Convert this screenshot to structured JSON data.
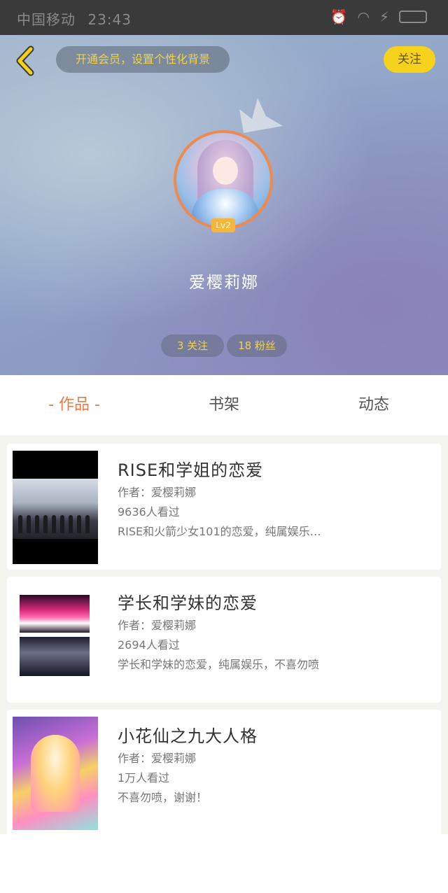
{
  "status_bar": {
    "carrier": "中国移动",
    "time": "23:43",
    "icons": [
      "alarm-icon",
      "wifi-icon",
      "charging-icon",
      "battery-icon"
    ]
  },
  "header": {
    "back_icon": "chevron-left-icon",
    "vip_promo": "开通会员，设置个性化背景",
    "follow_label": "关注"
  },
  "profile": {
    "level": "Lv2",
    "username": "爱樱莉娜",
    "following": "3 关注",
    "fans": "18 粉丝"
  },
  "tabs": [
    {
      "label": "- 作品 -",
      "active": true
    },
    {
      "label": "书架",
      "active": false
    },
    {
      "label": "动态",
      "active": false
    }
  ],
  "works": [
    {
      "title": "RISE和学姐的恋爱",
      "author": "作者：爱樱莉娜",
      "views": "9636人看过",
      "desc": "RISE和火箭少女101的恋爱，纯属娱乐…"
    },
    {
      "title": "学长和学妹的恋爱",
      "author": "作者：爱樱莉娜",
      "views": "2694人看过",
      "desc": "学长和学妹的恋爱，纯属娱乐，不喜勿喷"
    },
    {
      "title": "小花仙之九大人格",
      "author": "作者：爱樱莉娜",
      "views": "1万人看过",
      "desc": "不喜勿喷，谢谢！"
    }
  ],
  "colors": {
    "accent": "#ec7a45",
    "follow_button": "#f7d21c",
    "vip_text": "#f2d24a"
  }
}
